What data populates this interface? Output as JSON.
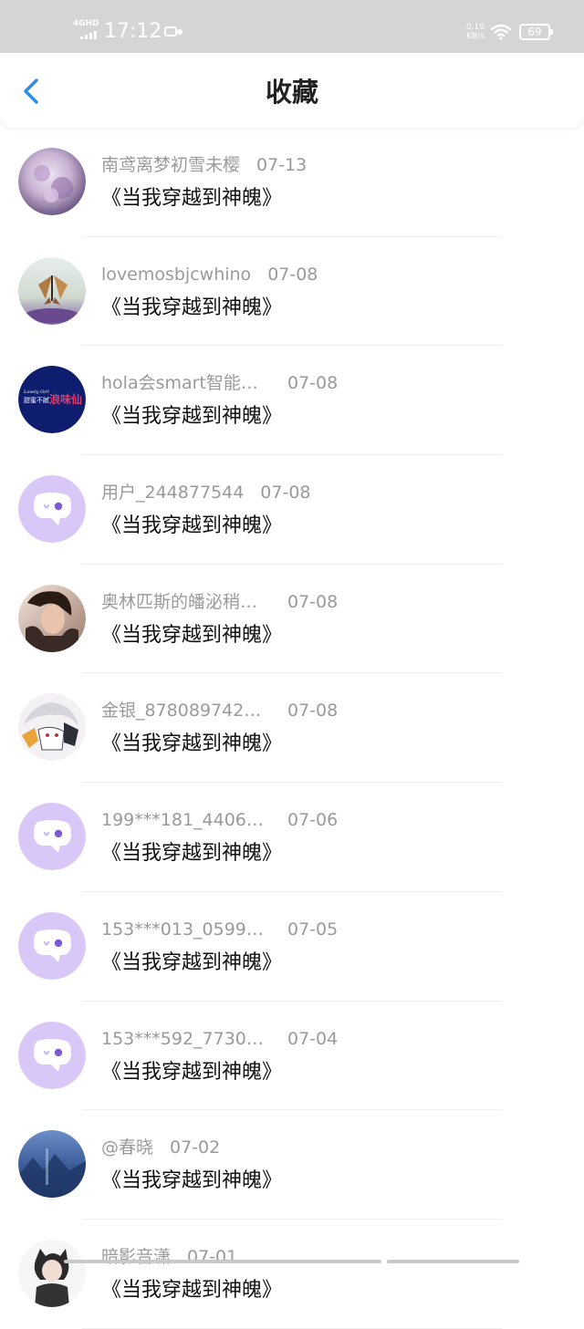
{
  "status_bar": {
    "network": "4GHD",
    "time": "17:12",
    "speed_value": "0.10",
    "speed_unit": "KB/s",
    "battery": "69"
  },
  "header": {
    "title": "收藏"
  },
  "icons": {
    "back": "chevron-left-icon",
    "default_avatar": "chat-bubble-face-icon"
  },
  "colors": {
    "accent": "#2d8cf0",
    "default_avatar_bg": "#d9c8f7"
  },
  "list": {
    "items": [
      {
        "name": "南鸢离梦初雪未樱",
        "date": "07-13",
        "title": "《当我穿越到神魄》",
        "avatar": "purple-flower-photo"
      },
      {
        "name": "lovemosbjcwhino",
        "date": "07-08",
        "title": "《当我穿越到神魄》",
        "avatar": "butterfly-photo"
      },
      {
        "name": "hola会smart智能…",
        "date": "07-08",
        "title": "《当我穿越到神魄》",
        "avatar": "navy-logo",
        "avatar_text": "浪味仙"
      },
      {
        "name": "用户_244877544",
        "date": "07-08",
        "title": "《当我穿越到神魄》",
        "avatar": "default"
      },
      {
        "name": "奥林匹斯的皤泌稍…",
        "date": "07-08",
        "title": "《当我穿越到神魄》",
        "avatar": "portrait-photo"
      },
      {
        "name": "金银_878089742…",
        "date": "07-08",
        "title": "《当我穿越到神魄》",
        "avatar": "anime-photo"
      },
      {
        "name": "199***181_4406…",
        "date": "07-06",
        "title": "《当我穿越到神魄》",
        "avatar": "default"
      },
      {
        "name": "153***013_0599…",
        "date": "07-05",
        "title": "《当我穿越到神魄》",
        "avatar": "default"
      },
      {
        "name": "153***592_7730…",
        "date": "07-04",
        "title": "《当我穿越到神魄》",
        "avatar": "default"
      },
      {
        "name": "@春晓",
        "date": "07-02",
        "title": "《当我穿越到神魄》",
        "avatar": "blue-landscape-photo"
      },
      {
        "name": "暗影音潇",
        "date": "07-01",
        "title": "《当我穿越到神魄》",
        "avatar": "anime-sketch-photo"
      }
    ]
  }
}
